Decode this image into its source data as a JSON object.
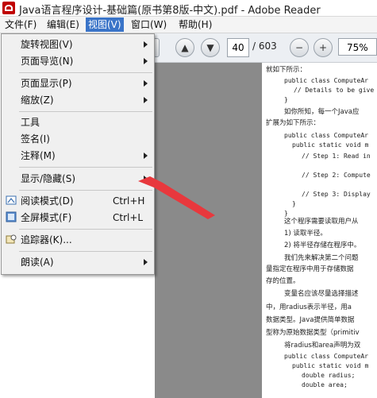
{
  "window": {
    "title": "Java语言程序设计-基础篇(原书第8版-中文).pdf - Adobe Reader"
  },
  "menubar": [
    {
      "label": "文件(F)"
    },
    {
      "label": "编辑(E)"
    },
    {
      "label": "视图(V)"
    },
    {
      "label": "窗口(W)"
    },
    {
      "label": "帮助(H)"
    }
  ],
  "toolbar": {
    "page_current": "40",
    "page_total": "/ 603",
    "zoom": "75%"
  },
  "view_menu": [
    {
      "label": "旋转视图(V)",
      "submenu": true
    },
    {
      "label": "页面导览(N)",
      "submenu": true
    },
    {
      "label": "页面显示(P)",
      "submenu": true
    },
    {
      "label": "缩放(Z)",
      "submenu": true
    },
    {
      "label": "工具",
      "submenu": false
    },
    {
      "label": "签名(I)",
      "submenu": false
    },
    {
      "label": "注释(M)",
      "submenu": true
    },
    {
      "label": "显示/隐藏(S)",
      "submenu": true
    },
    {
      "label": "阅读模式(D)",
      "shortcut": "Ctrl+H",
      "icon": "read-mode-icon"
    },
    {
      "label": "全屏模式(F)",
      "shortcut": "Ctrl+L",
      "icon": "fullscreen-icon"
    },
    {
      "label": "追踪器(K)...",
      "icon": "tracker-icon"
    },
    {
      "label": "朗读(A)",
      "submenu": true
    }
  ],
  "document_lines": [
    "就如下所示：",
    "public class ComputeAr",
    "  // Details to be give",
    "}",
    "如你所知，每一个Java应",
    "扩展为如下所示：",
    "public class ComputeAr",
    "  public static void m",
    "    // Step 1: Read in",
    "",
    "    // Step 2: Compute",
    "",
    "    // Step 3: Display",
    "  }",
    "}",
    "这个程序需要读取用户从",
    "1) 读取半径。",
    "2) 将半径存储在程序中。",
    "我们先来解决第二个问题",
    "量指定在程序中用于存储数据",
    "存的位置。",
    "变量名应该尽量选择描述",
    "中，用radius表示半径，用a",
    "数据类型。Java提供简单数据",
    "型称为原始数据类型（primitiv",
    "将radius和area声明为双",
    "public class ComputeAr",
    "  public static void m",
    "    double radius;",
    "    double area;"
  ],
  "colors": {
    "menu_highlight": "#3a74c8",
    "annotation_arrow": "#e8383d"
  }
}
